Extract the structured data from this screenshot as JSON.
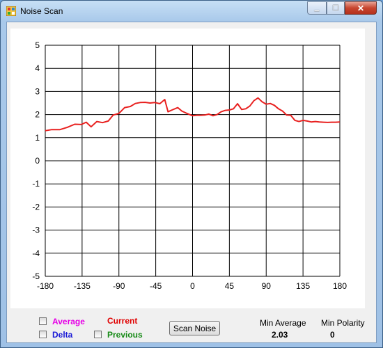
{
  "window": {
    "title": "Noise Scan",
    "min_glyph": "▁",
    "max_glyph": "☐",
    "close_glyph": "✕"
  },
  "chart_data": {
    "type": "line",
    "title": "",
    "xlabel": "",
    "ylabel": "",
    "xlim": [
      -180,
      180
    ],
    "ylim": [
      -5,
      5
    ],
    "x_ticks": [
      "-180",
      "-135",
      "-90",
      "-45",
      "0",
      "45",
      "90",
      "135",
      "180"
    ],
    "y_ticks": [
      "5",
      "4",
      "3",
      "2",
      "1",
      "0",
      "-1",
      "-2",
      "-3",
      "-4",
      "-5"
    ],
    "grid": true,
    "series": [
      {
        "color": "#e8201f",
        "x": [
          -180,
          -172,
          -162,
          -153,
          -144,
          -136,
          -130,
          -124,
          -117,
          -110,
          -103,
          -97,
          -90,
          -83,
          -76,
          -70,
          -64,
          -58,
          -52,
          -46,
          -40,
          -34,
          -30,
          -25,
          -18,
          -13,
          -7,
          0,
          5,
          10,
          15,
          20,
          25,
          30,
          35,
          40,
          45,
          50,
          55,
          60,
          65,
          70,
          75,
          80,
          85,
          90,
          95,
          100,
          105,
          110,
          115,
          120,
          125,
          130,
          135,
          140,
          145,
          150,
          155,
          160,
          165,
          170,
          175,
          180
        ],
        "y": [
          1.3,
          1.35,
          1.35,
          1.45,
          1.58,
          1.57,
          1.67,
          1.47,
          1.7,
          1.65,
          1.72,
          1.98,
          2.05,
          2.3,
          2.35,
          2.48,
          2.52,
          2.53,
          2.5,
          2.52,
          2.47,
          2.65,
          2.12,
          2.2,
          2.3,
          2.15,
          2.05,
          1.95,
          1.97,
          1.97,
          1.98,
          2.02,
          1.95,
          2.0,
          2.12,
          2.18,
          2.2,
          2.25,
          2.47,
          2.22,
          2.25,
          2.37,
          2.6,
          2.72,
          2.55,
          2.45,
          2.48,
          2.4,
          2.25,
          2.15,
          1.98,
          1.97,
          1.75,
          1.7,
          1.75,
          1.72,
          1.68,
          1.7,
          1.68,
          1.67,
          1.66,
          1.67,
          1.67,
          1.68
        ]
      }
    ]
  },
  "controls": {
    "average_label": "Average",
    "delta_label": "Delta",
    "current_label": "Current",
    "previous_label": "Previous",
    "scan_button": "Scan Noise",
    "min_average_label": "Min Average",
    "min_average_value": "2.03",
    "min_polarity_label": "Min Polarity",
    "min_polarity_value": "0"
  },
  "colors": {
    "average": "#e600e6",
    "delta": "#1a1ad6",
    "current": "#e00000",
    "previous": "#168a16"
  }
}
